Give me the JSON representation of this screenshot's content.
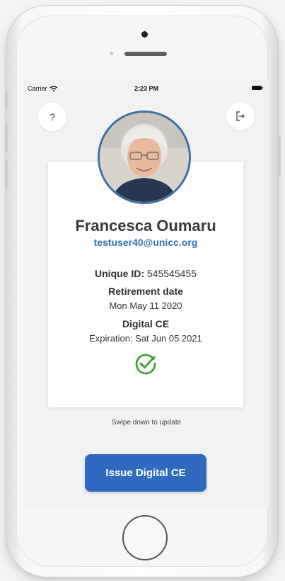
{
  "status_bar": {
    "carrier": "Carrier",
    "time": "2:23 PM"
  },
  "header": {
    "help_label": "?",
    "logout_icon": "logout-icon"
  },
  "profile": {
    "name": "Francesca Oumaru",
    "email": "testuser40@unicc.org",
    "unique_id_label": "Unique ID:",
    "unique_id_value": "545545455",
    "retirement_title": "Retirement date",
    "retirement_value": "Mon May 11 2020",
    "ce_title": "Digital CE",
    "ce_expiration": "Expiration: Sat Jun 05 2021",
    "status_icon": "check-circle-icon",
    "status_color": "#3aa02a"
  },
  "footer": {
    "swipe_hint": "Swipe down to update",
    "issue_button": "Issue Digital CE",
    "accent_color": "#2e6bc0"
  }
}
